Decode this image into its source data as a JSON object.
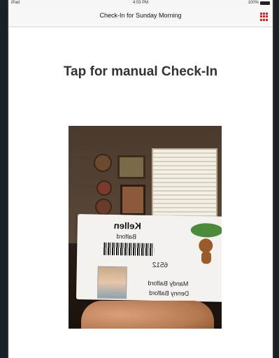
{
  "status_bar": {
    "left": "iPad",
    "time": "4:03 PM",
    "battery": "100%"
  },
  "navbar": {
    "title": "Check-In for Sunday Morning",
    "menu_icon": "grid-icon",
    "accent_color": "#e02020"
  },
  "main": {
    "headline": "Tap for manual Check-In",
    "camera_preview": {
      "card": {
        "first_name": "Kellen",
        "last_name": "Balford",
        "code": "6512",
        "parents": [
          "Mandy Balford",
          "Denny Balford"
        ]
      }
    }
  }
}
